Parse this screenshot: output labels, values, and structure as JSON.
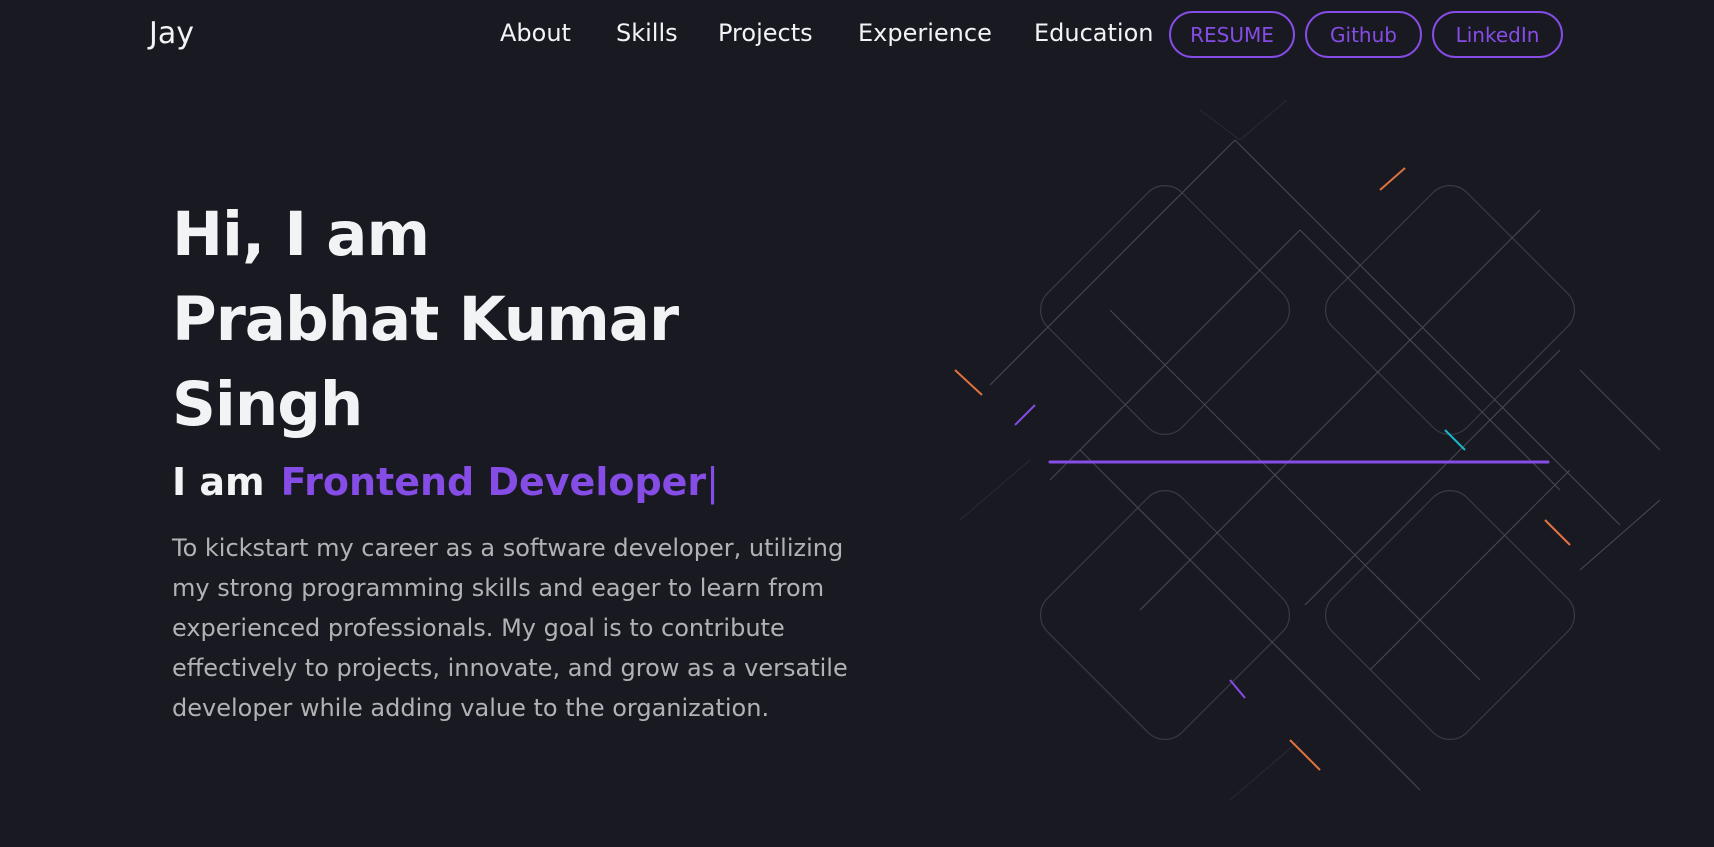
{
  "nav": {
    "logo": "Jay",
    "links": [
      "About",
      "Skills",
      "Projects",
      "Experience",
      "Education"
    ],
    "buttons": [
      "RESUME",
      "Github",
      "LinkedIn"
    ]
  },
  "hero": {
    "title_line1": "Hi, I am",
    "title_line2": "Prabhat Kumar",
    "title_line3": "Singh",
    "role_prefix": "I am",
    "role": "Frontend Developer",
    "caret": "|",
    "description": "To kickstart my career as a software developer, utilizing my strong programming skills and eager to learn from experienced professionals. My goal is to contribute effectively to projects, innovate, and grow as a versatile developer while adding value to the organization."
  },
  "colors": {
    "background": "#191922",
    "text": "#f2f3f4",
    "accent": "#854ce6",
    "muted_text": "#b1b2b3"
  }
}
